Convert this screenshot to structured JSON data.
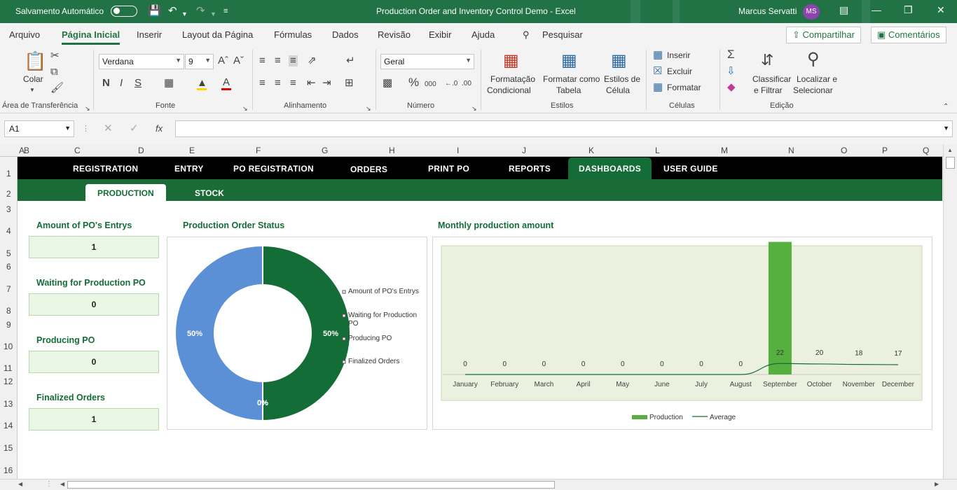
{
  "titlebar": {
    "autosave_label": "Salvamento Automático",
    "doc_title": "Production Order and Inventory Control Demo  -  Excel",
    "user_name": "Marcus Servatti",
    "user_initials": "MS"
  },
  "menu": {
    "tabs": [
      "Arquivo",
      "Página Inicial",
      "Inserir",
      "Layout da Página",
      "Fórmulas",
      "Dados",
      "Revisão",
      "Exibir",
      "Ajuda"
    ],
    "search": "Pesquisar",
    "share": "Compartilhar",
    "comments": "Comentários"
  },
  "ribbon": {
    "paste": "Colar",
    "clipboard_group": "Área de Transferência",
    "font_name": "Verdana",
    "font_size": "9",
    "font_group": "Fonte",
    "bold": "N",
    "italic": "I",
    "underline": "S",
    "alignment_group": "Alinhamento",
    "number_format": "Geral",
    "number_group": "Número",
    "cond_format_1": "Formatação",
    "cond_format_2": "Condicional",
    "format_table_1": "Formatar como",
    "format_table_2": "Tabela",
    "cell_styles_1": "Estilos de",
    "cell_styles_2": "Célula",
    "styles_group": "Estilos",
    "insert": "Inserir",
    "delete": "Excluir",
    "format": "Formatar",
    "cells_group": "Células",
    "sort_1": "Classificar",
    "sort_2": "e Filtrar",
    "find_1": "Localizar e",
    "find_2": "Selecionar",
    "edit_group": "Edição"
  },
  "formula_bar": {
    "cell_ref": "A1",
    "formula": ""
  },
  "grid": {
    "columns": [
      "A",
      "B",
      "C",
      "D",
      "E",
      "F",
      "G",
      "H",
      "I",
      "J",
      "K",
      "L",
      "M",
      "N",
      "O",
      "P",
      "Q"
    ],
    "rows": [
      "1",
      "2",
      "3",
      "4",
      "5",
      "6",
      "7",
      "8",
      "9",
      "10",
      "11",
      "12",
      "13",
      "14",
      "15",
      "16"
    ]
  },
  "nav": {
    "items": [
      "REGISTRATION",
      "ENTRY",
      "PO REGISTRATION",
      "ORDERS",
      "PRINT PO",
      "REPORTS",
      "DASHBOARDS",
      "USER GUIDE"
    ],
    "sub_tabs": [
      "PRODUCTION",
      "STOCK"
    ]
  },
  "kpis": [
    {
      "title": "Amount of PO's Entrys",
      "value": "1"
    },
    {
      "title": "Waiting for Production PO",
      "value": "0"
    },
    {
      "title": "Producing PO",
      "value": "0"
    },
    {
      "title": "Finalized Orders",
      "value": "1"
    }
  ],
  "colors": {
    "brand_green": "#217346",
    "dark_green": "#146c37",
    "donut_blue": "#5b8fd6",
    "bar_green": "#56b03f",
    "chart_bg": "#ebf1de"
  },
  "chart_data": [
    {
      "type": "pie",
      "title": "Production Order Status",
      "categories": [
        "Amount of PO's Entrys",
        "Waiting for Production PO",
        "Producing PO",
        "Finalized Orders"
      ],
      "values": [
        50,
        0,
        0,
        50
      ],
      "labels": [
        "50%",
        "0%",
        "0%",
        "50%"
      ],
      "legend": "right"
    },
    {
      "type": "bar",
      "title": "Monthly production amount",
      "categories": [
        "January",
        "February",
        "March",
        "April",
        "May",
        "June",
        "July",
        "August",
        "September",
        "October",
        "November",
        "December"
      ],
      "series": [
        {
          "name": "Production",
          "values": [
            0,
            0,
            0,
            0,
            0,
            0,
            0,
            0,
            22,
            0,
            0,
            0
          ]
        },
        {
          "name": "Average",
          "values": [
            0,
            0,
            0,
            0,
            0,
            0,
            0,
            0,
            22,
            20,
            18,
            17
          ]
        }
      ],
      "data_labels": [
        "0",
        "0",
        "0",
        "0",
        "0",
        "0",
        "0",
        "0",
        "22",
        "20",
        "18",
        "17"
      ],
      "ylim": [
        0,
        40
      ],
      "legend": "bottom"
    }
  ]
}
